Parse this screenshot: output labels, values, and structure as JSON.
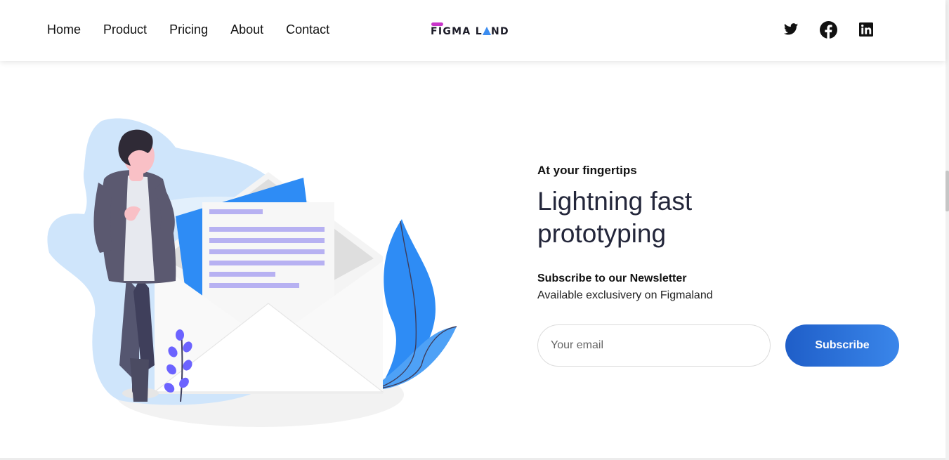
{
  "nav": {
    "items": [
      {
        "label": "Home"
      },
      {
        "label": "Product"
      },
      {
        "label": "Pricing"
      },
      {
        "label": "About"
      },
      {
        "label": "Contact"
      }
    ]
  },
  "logo": {
    "text_prefix": "FIGMA L",
    "text_suffix": "ND"
  },
  "social": {
    "icons": [
      "twitter-icon",
      "facebook-icon",
      "linkedin-icon"
    ]
  },
  "hero": {
    "eyebrow": "At your fingertips",
    "headline": "Lightning fast prototyping",
    "newsletter_title": "Subscribe to our Newsletter",
    "newsletter_sub": "Available exclusivery on Figmaland",
    "email_placeholder": "Your email",
    "subscribe_label": "Subscribe"
  },
  "colors": {
    "accent_blue": "#2f80ed",
    "button_start": "#1f5ec8",
    "button_end": "#3a86ea",
    "logo_magenta": "#c935c9",
    "headline": "#23263a"
  }
}
